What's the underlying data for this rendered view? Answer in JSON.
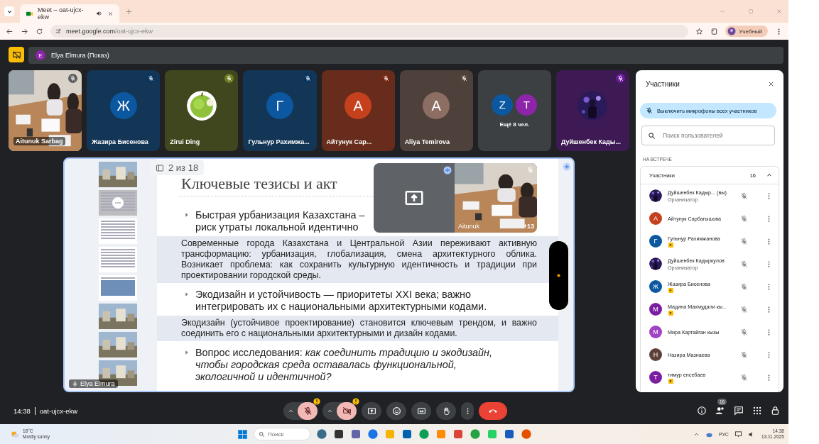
{
  "browser": {
    "tab_title": "Meet – oat-ujcx-ekw",
    "url_host": "meet.google.com",
    "url_path": "/oat-ujcx-ekw",
    "profile": "Учебный"
  },
  "presenter_bar": {
    "avatar": "E",
    "label": "Elya Elmura (Показ)"
  },
  "tiles": [
    {
      "kind": "camera",
      "name": "Aitunuk Sarbag"
    },
    {
      "kind": "letter",
      "name": "Жазира Бисенова",
      "initial": "Ж",
      "color": "#0b57a0"
    },
    {
      "name": "Zirui Ding",
      "color": "#6f7d22"
    },
    {
      "kind": "letter",
      "name": "Гульнур Рахимжа...",
      "initial": "Г",
      "color": "#0b57a0"
    },
    {
      "kind": "letter",
      "name": "Айтунук Сар...",
      "initial": "А",
      "color": "#c5411e"
    },
    {
      "kind": "letter",
      "name": "Aliya Temirova",
      "initial": "А",
      "color": "#8d6e63"
    },
    {
      "kind": "more",
      "label": "Ещё 8 чел.",
      "avatars": [
        {
          "initial": "Z",
          "color": "#0b57a0"
        },
        {
          "initial": "Т",
          "color": "#8e24aa"
        }
      ]
    },
    {
      "name": "Дуйшенбек Кады...",
      "color": "#6a1b9a"
    }
  ],
  "slide": {
    "counter": "2 из 18",
    "title": "Ключевые тезисы и акт",
    "thumbnails": [
      {
        "kind": "picture",
        "selected": false
      },
      {
        "kind": "text",
        "selected": true
      },
      {
        "kind": "text",
        "selected": false
      },
      {
        "kind": "text",
        "selected": false
      },
      {
        "kind": "table",
        "selected": false
      },
      {
        "kind": "picture",
        "selected": false
      },
      {
        "kind": "picture",
        "selected": false
      },
      {
        "kind": "picture",
        "selected": false
      }
    ],
    "presenter_label": "Elya Elmura",
    "items": [
      {
        "kind": "bullet",
        "text": "Быстрая урбанизация Казахстана –\nриск утраты локальной идентично"
      },
      {
        "kind": "note",
        "text": "Современные города Казахстана и Центральной Азии переживают активную трансформацию: урбанизация, глобализация, смена архитектурного облика. Возникает проблема: как сохранить культурную идентичность и традиции при проектировании городской среды."
      },
      {
        "kind": "bullet",
        "text": "Экодизайн и устойчивость — приоритеты XXI века; важно\nинтегрировать их с национальными архитектурными кодами."
      },
      {
        "kind": "note",
        "text": "Экодизайн (устойчивое проектирование) становится ключевым трендом, и важно соединить его с национальными архитектурными и дизайн кодами."
      },
      {
        "kind": "bullet",
        "text": "Вопрос исследования: *как соединить традицию и экодизайн,*\n*чтобы городская среда оставалась функциональной,*\n*экологичной и идентичной?*"
      }
    ],
    "self_view": {
      "name": "Aitunuk",
      "count": "+13"
    }
  },
  "panel": {
    "title": "Участники",
    "mute_all": "Выключить микрофоны всех участников",
    "search_placeholder": "Поиск пользователей",
    "section": "НА ВСТРЕЧЕ",
    "group": {
      "label": "Участники",
      "count": "16",
      "expanded": true
    },
    "people": [
      {
        "name": "Дуйшенбек Кадыр... (вы)",
        "role": "Организатор",
        "badge": false
      },
      {
        "kind": "letter",
        "name": "Айтунук Сарбагышова",
        "initial": "А",
        "color": "#c5411e",
        "badge": false
      },
      {
        "kind": "letter",
        "name": "Гульнур Рахимжанова",
        "initial": "Г",
        "color": "#0b57a0",
        "badge": true
      },
      {
        "name": "Дуйшенбек Кадыркулов",
        "role": "Организатор",
        "badge": false
      },
      {
        "kind": "letter",
        "name": "Жазира Бисенова",
        "initial": "Ж",
        "color": "#0b57a0",
        "badge": true
      },
      {
        "kind": "letter",
        "name": "Мадина Махмудали кы...",
        "initial": "М",
        "color": "#7b1fa2",
        "badge": true
      },
      {
        "kind": "letter",
        "name": "Мира Картайган кызы",
        "initial": "М",
        "color": "#a142c4",
        "badge": false
      },
      {
        "kind": "letter",
        "name": "Назира Мазнаева",
        "initial": "Н",
        "color": "#5d4037",
        "badge": false
      },
      {
        "kind": "letter",
        "name": "тимур енсебаев",
        "initial": "Т",
        "color": "#7b1fa2",
        "badge": true
      }
    ]
  },
  "controls": {
    "time": "14:38",
    "code": "oat-ujcx-ekw",
    "mic": {
      "muted": true
    },
    "camera": {
      "muted": true
    },
    "participants_count": "16"
  },
  "taskbar": {
    "temperature": "18°C",
    "weather": "Mostly sunny",
    "search_placeholder": "Поиск",
    "language": "РУС",
    "time": "14:38",
    "date": "13.11.2025"
  }
}
